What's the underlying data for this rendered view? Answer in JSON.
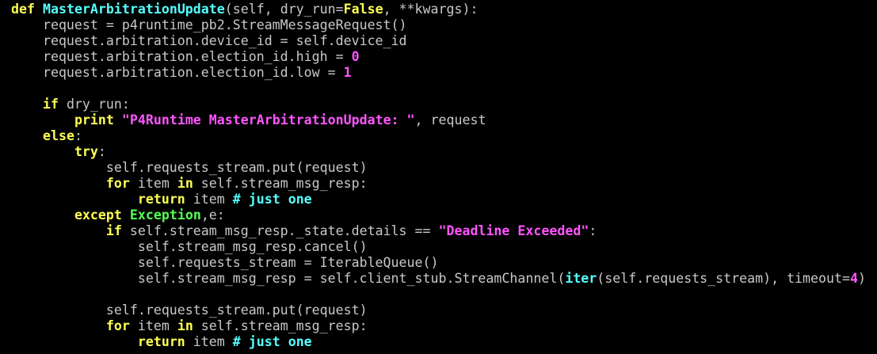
{
  "editor": {
    "background": "#000000",
    "colors": {
      "keyword": "#ffff55",
      "function_name": "#55ffff",
      "string": "#ff55ff",
      "number": "#ff55ff",
      "comment": "#55ffff",
      "exception": "#55ff55",
      "text": "#c8c8c8"
    },
    "lines": [
      [
        [
          "kw",
          "def"
        ],
        [
          "plain",
          " "
        ],
        [
          "fn",
          "MasterArbitrationUpdate"
        ],
        [
          "plain",
          "(self, dry_run="
        ],
        [
          "const",
          "False"
        ],
        [
          "plain",
          ", **kwargs):"
        ]
      ],
      [
        [
          "plain",
          "    request = p4runtime_pb2.StreamMessageRequest()"
        ]
      ],
      [
        [
          "plain",
          "    request.arbitration.device_id = self.device_id"
        ]
      ],
      [
        [
          "plain",
          "    request.arbitration.election_id.high = "
        ],
        [
          "num",
          "0"
        ]
      ],
      [
        [
          "plain",
          "    request.arbitration.election_id.low = "
        ],
        [
          "num",
          "1"
        ]
      ],
      [],
      [
        [
          "plain",
          "    "
        ],
        [
          "kw",
          "if"
        ],
        [
          "plain",
          " dry_run:"
        ]
      ],
      [
        [
          "plain",
          "        "
        ],
        [
          "kw",
          "print"
        ],
        [
          "plain",
          " "
        ],
        [
          "str",
          "\"P4Runtime MasterArbitrationUpdate: \""
        ],
        [
          "plain",
          ", request"
        ]
      ],
      [
        [
          "plain",
          "    "
        ],
        [
          "kw",
          "else"
        ],
        [
          "plain",
          ":"
        ]
      ],
      [
        [
          "plain",
          "        "
        ],
        [
          "kw",
          "try"
        ],
        [
          "plain",
          ":"
        ]
      ],
      [
        [
          "plain",
          "            self.requests_stream.put(request)"
        ]
      ],
      [
        [
          "plain",
          "            "
        ],
        [
          "kw",
          "for"
        ],
        [
          "plain",
          " item "
        ],
        [
          "kw",
          "in"
        ],
        [
          "plain",
          " self.stream_msg_resp:"
        ]
      ],
      [
        [
          "plain",
          "                "
        ],
        [
          "kw",
          "return"
        ],
        [
          "plain",
          " item "
        ],
        [
          "comment",
          "# just one"
        ]
      ],
      [
        [
          "plain",
          "        "
        ],
        [
          "kw",
          "except"
        ],
        [
          "plain",
          " "
        ],
        [
          "exc",
          "Exception"
        ],
        [
          "plain",
          ",e:"
        ]
      ],
      [
        [
          "plain",
          "            "
        ],
        [
          "kw",
          "if"
        ],
        [
          "plain",
          " self.stream_msg_resp._state.details == "
        ],
        [
          "str",
          "\"Deadline Exceeded\""
        ],
        [
          "plain",
          ":"
        ]
      ],
      [
        [
          "plain",
          "                self.stream_msg_resp.cancel()"
        ]
      ],
      [
        [
          "plain",
          "                self.requests_stream = IterableQueue()"
        ]
      ],
      [
        [
          "plain",
          "                self.stream_msg_resp = self.client_stub.StreamChannel("
        ],
        [
          "builtin",
          "iter"
        ],
        [
          "plain",
          "(self.requests_stream), timeout="
        ],
        [
          "num",
          "4"
        ],
        [
          "plain",
          ")"
        ]
      ],
      [],
      [
        [
          "plain",
          "            self.requests_stream.put(request)"
        ]
      ],
      [
        [
          "plain",
          "            "
        ],
        [
          "kw",
          "for"
        ],
        [
          "plain",
          " item "
        ],
        [
          "kw",
          "in"
        ],
        [
          "plain",
          " self.stream_msg_resp:"
        ]
      ],
      [
        [
          "plain",
          "                "
        ],
        [
          "kw",
          "return"
        ],
        [
          "plain",
          " item "
        ],
        [
          "comment",
          "# just one"
        ]
      ]
    ]
  }
}
